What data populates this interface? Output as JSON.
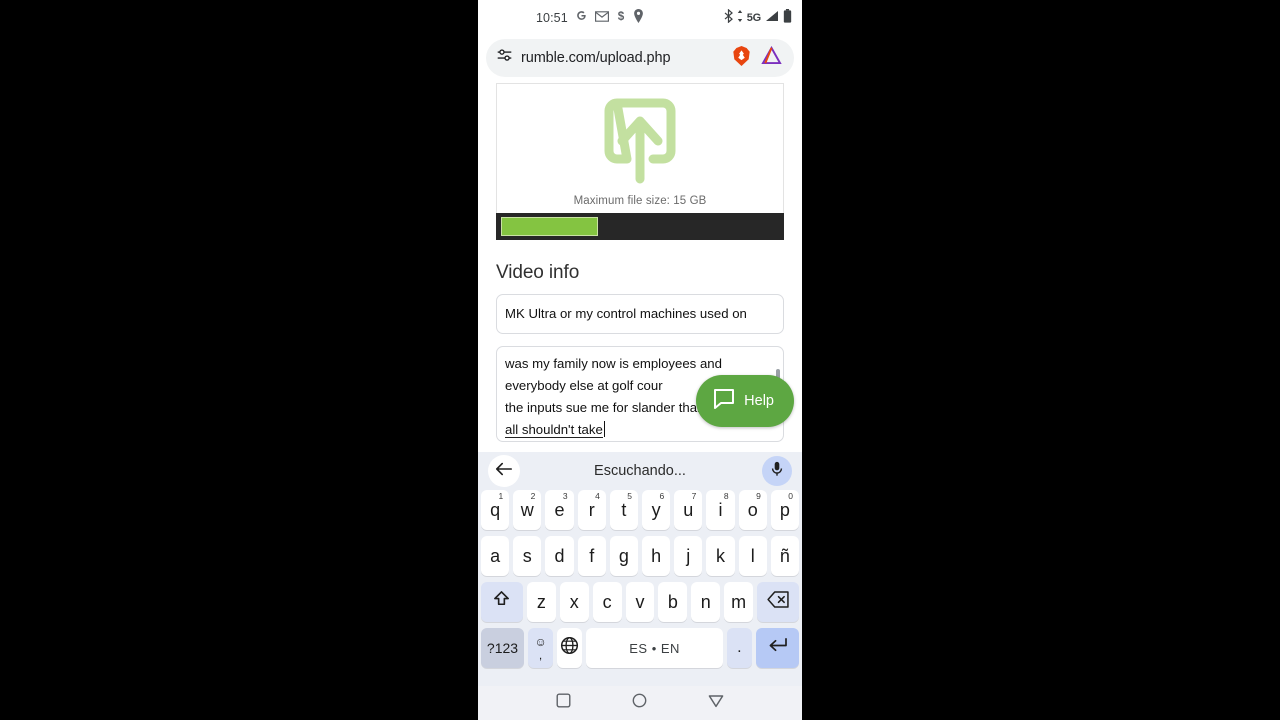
{
  "status_bar": {
    "time": "10:51",
    "left_icons": [
      "google-icon",
      "gmail-icon",
      "dollar-icon",
      "location-pin-icon"
    ],
    "right_icons": [
      "bluetooth-icon",
      "5g-icon",
      "signal-bars-icon",
      "battery-icon"
    ],
    "network_label": "5G"
  },
  "browser": {
    "url": "rumble.com/upload.php",
    "tune_icon": "tune-sliders-icon",
    "shield_icon": "brave-lion-shield-icon",
    "rewards_icon": "brave-triangle-icon"
  },
  "page": {
    "upload": {
      "icon": "upload-arrow-box-icon",
      "max_size_label": "Maximum file size: 15 GB",
      "progress_percent": 35,
      "progress_fill_color": "#84c441",
      "progress_track_color": "#272727"
    },
    "video_info": {
      "heading": "Video info",
      "title_value": "MK Ultra or my control machines used on",
      "description_lines": [
        "was my family now is employees and",
        "everybody else at golf cour",
        "the inputs sue me for slander thank you",
        "all shouldn't take"
      ]
    },
    "help_button": {
      "label": "Help",
      "icon": "chat-bubble-icon",
      "color": "#5da742"
    }
  },
  "keyboard": {
    "status_text": "Escuchando...",
    "back_icon": "arrow-left-icon",
    "mic_icon": "microphone-icon",
    "row1": [
      {
        "label": "q",
        "num": "1"
      },
      {
        "label": "w",
        "num": "2"
      },
      {
        "label": "e",
        "num": "3"
      },
      {
        "label": "r",
        "num": "4"
      },
      {
        "label": "t",
        "num": "5"
      },
      {
        "label": "y",
        "num": "6"
      },
      {
        "label": "u",
        "num": "7"
      },
      {
        "label": "i",
        "num": "8"
      },
      {
        "label": "o",
        "num": "9"
      },
      {
        "label": "p",
        "num": "0"
      }
    ],
    "row2": [
      "a",
      "s",
      "d",
      "f",
      "g",
      "h",
      "j",
      "k",
      "l",
      "ñ"
    ],
    "row3_letters": [
      "z",
      "x",
      "c",
      "v",
      "b",
      "n",
      "m"
    ],
    "shift_icon": "shift-arrow-icon",
    "backspace_icon": "backspace-icon",
    "symbols_key": "?123",
    "emoji_key_top": "☺",
    "emoji_key_bottom": ",",
    "globe_icon": "globe-language-icon",
    "space_label": "ES • EN",
    "period_key": ".",
    "enter_icon": "enter-return-icon"
  },
  "nav_bar": {
    "recents_icon": "square-recents-icon",
    "home_icon": "circle-home-icon",
    "back_icon": "triangle-back-icon"
  }
}
